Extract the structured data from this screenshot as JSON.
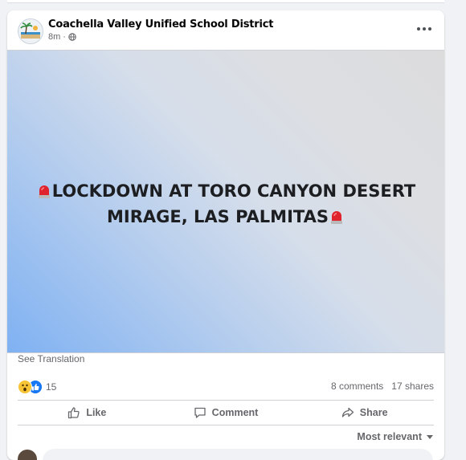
{
  "post": {
    "page_name": "Coachella Valley Unified School District",
    "time": "8m",
    "meta_separator": "·",
    "image_text_line1": "LOCKDOWN AT TORO CANYON DESERT",
    "image_text_line2": "MIRAGE, LAS PALMITAS",
    "see_translation": "See Translation"
  },
  "reactions": {
    "count": "15",
    "icons": [
      "wow-icon",
      "like-icon"
    ]
  },
  "stats": {
    "comments": "8 comments",
    "shares": "17 shares"
  },
  "actions": {
    "like": "Like",
    "comment": "Comment",
    "share": "Share"
  },
  "comments": {
    "sort_label": "Most relevant"
  },
  "colors": {
    "text_primary": "#050505",
    "text_secondary": "#65676b",
    "siren": "#e0242e",
    "like_blue": "#1877f2",
    "wow_yellow": "#f7c437"
  }
}
